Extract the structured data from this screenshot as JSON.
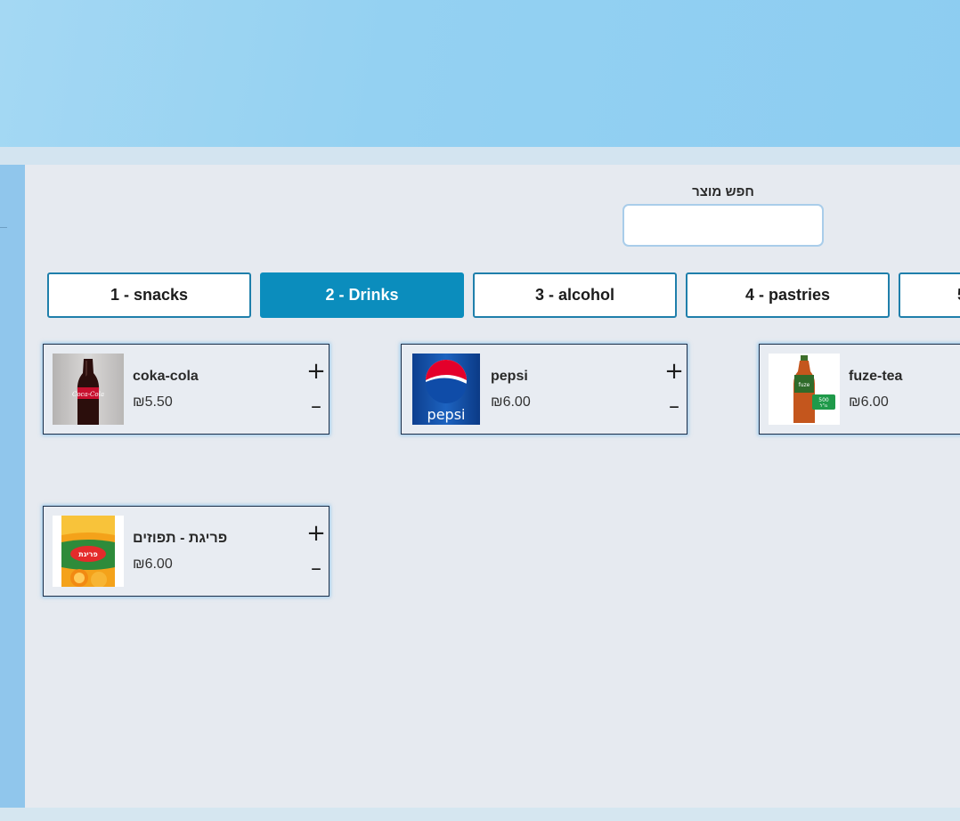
{
  "search": {
    "label": "חפש מוצר",
    "value": "",
    "placeholder": ""
  },
  "categories": [
    {
      "label": "1 - snacks",
      "active": false
    },
    {
      "label": "2 - Drinks",
      "active": true
    },
    {
      "label": "3 - alcohol",
      "active": false
    },
    {
      "label": "4 - pastries",
      "active": false
    },
    {
      "label": "5",
      "active": false
    }
  ],
  "products": [
    {
      "name": "coka-cola",
      "price": "₪5.50",
      "image_icon": "coca-cola-bottle-icon",
      "plus": "+",
      "minus": "–"
    },
    {
      "name": "pepsi",
      "price": "₪6.00",
      "image_icon": "pepsi-can-icon",
      "plus": "+",
      "minus": "–"
    },
    {
      "name": "fuze-tea",
      "price": "₪6.00",
      "image_icon": "fuze-tea-bottle-icon",
      "plus": "+",
      "minus": "–"
    },
    {
      "name": "פריגת - תפוזים",
      "price": "₪6.00",
      "image_icon": "prigat-orange-juice-icon",
      "plus": "+",
      "minus": "–"
    }
  ],
  "colors": {
    "header": "#94d1f2",
    "accent": "#0b8dbd",
    "card_border": "#1b2f4a",
    "background": "#e6eaf0"
  }
}
